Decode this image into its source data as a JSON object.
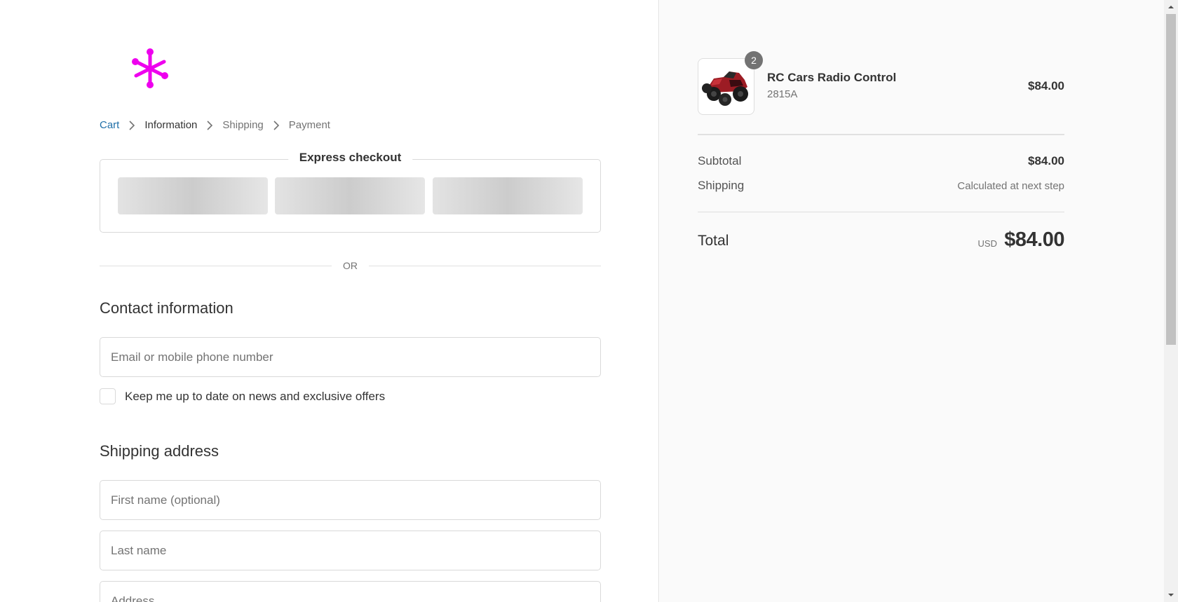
{
  "breadcrumb": {
    "items": [
      {
        "label": "Cart"
      },
      {
        "label": "Information"
      },
      {
        "label": "Shipping"
      },
      {
        "label": "Payment"
      }
    ]
  },
  "express": {
    "title": "Express checkout",
    "or_text": "OR"
  },
  "contact": {
    "title": "Contact information",
    "email_placeholder": "Email or mobile phone number",
    "newsletter_label": "Keep me up to date on news and exclusive offers",
    "newsletter_checked": false
  },
  "shipping": {
    "title": "Shipping address",
    "first_name_placeholder": "First name (optional)",
    "last_name_placeholder": "Last name",
    "address_placeholder": "Address"
  },
  "summary": {
    "product": {
      "name": "RC Cars Radio Control",
      "variant": "2815A",
      "price": "$84.00",
      "quantity": "2",
      "image_icon": "rc-car-image"
    },
    "subtotal_label": "Subtotal",
    "subtotal_value": "$84.00",
    "shipping_label": "Shipping",
    "shipping_value": "Calculated at next step",
    "total_label": "Total",
    "total_currency": "USD",
    "total_value": "$84.00"
  },
  "colors": {
    "logo": "#ee00ee",
    "link": "#1f6fa8",
    "sidebar_bg": "#fafafa"
  }
}
